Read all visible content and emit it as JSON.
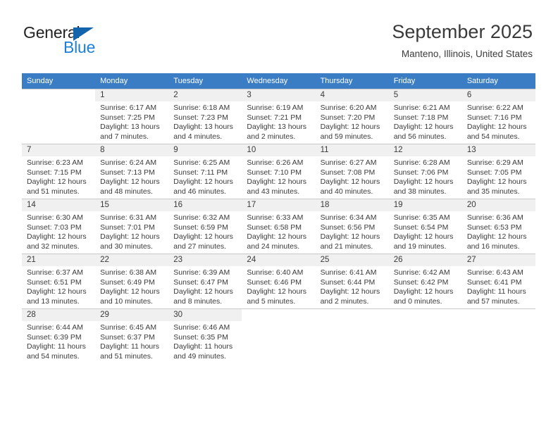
{
  "brand": {
    "name_top": "General",
    "name_bottom": "Blue",
    "color_blue": "#1e7fd4",
    "color_triangle": "#1264ac",
    "color_dark": "#222222"
  },
  "header": {
    "month_title": "September 2025",
    "location": "Manteno, Illinois, United States"
  },
  "calendar": {
    "header_bg": "#3b7dc4",
    "daynum_bg": "#f0f0f0",
    "grid_line": "#c9c9c9",
    "weekday_headers": [
      "Sunday",
      "Monday",
      "Tuesday",
      "Wednesday",
      "Thursday",
      "Friday",
      "Saturday"
    ],
    "weeks": [
      [
        {
          "day": "",
          "sunrise": "",
          "sunset": "",
          "daylight_line1": "",
          "daylight_line2": ""
        },
        {
          "day": "1",
          "sunrise": "Sunrise: 6:17 AM",
          "sunset": "Sunset: 7:25 PM",
          "daylight_line1": "Daylight: 13 hours",
          "daylight_line2": "and 7 minutes."
        },
        {
          "day": "2",
          "sunrise": "Sunrise: 6:18 AM",
          "sunset": "Sunset: 7:23 PM",
          "daylight_line1": "Daylight: 13 hours",
          "daylight_line2": "and 4 minutes."
        },
        {
          "day": "3",
          "sunrise": "Sunrise: 6:19 AM",
          "sunset": "Sunset: 7:21 PM",
          "daylight_line1": "Daylight: 13 hours",
          "daylight_line2": "and 2 minutes."
        },
        {
          "day": "4",
          "sunrise": "Sunrise: 6:20 AM",
          "sunset": "Sunset: 7:20 PM",
          "daylight_line1": "Daylight: 12 hours",
          "daylight_line2": "and 59 minutes."
        },
        {
          "day": "5",
          "sunrise": "Sunrise: 6:21 AM",
          "sunset": "Sunset: 7:18 PM",
          "daylight_line1": "Daylight: 12 hours",
          "daylight_line2": "and 56 minutes."
        },
        {
          "day": "6",
          "sunrise": "Sunrise: 6:22 AM",
          "sunset": "Sunset: 7:16 PM",
          "daylight_line1": "Daylight: 12 hours",
          "daylight_line2": "and 54 minutes."
        }
      ],
      [
        {
          "day": "7",
          "sunrise": "Sunrise: 6:23 AM",
          "sunset": "Sunset: 7:15 PM",
          "daylight_line1": "Daylight: 12 hours",
          "daylight_line2": "and 51 minutes."
        },
        {
          "day": "8",
          "sunrise": "Sunrise: 6:24 AM",
          "sunset": "Sunset: 7:13 PM",
          "daylight_line1": "Daylight: 12 hours",
          "daylight_line2": "and 48 minutes."
        },
        {
          "day": "9",
          "sunrise": "Sunrise: 6:25 AM",
          "sunset": "Sunset: 7:11 PM",
          "daylight_line1": "Daylight: 12 hours",
          "daylight_line2": "and 46 minutes."
        },
        {
          "day": "10",
          "sunrise": "Sunrise: 6:26 AM",
          "sunset": "Sunset: 7:10 PM",
          "daylight_line1": "Daylight: 12 hours",
          "daylight_line2": "and 43 minutes."
        },
        {
          "day": "11",
          "sunrise": "Sunrise: 6:27 AM",
          "sunset": "Sunset: 7:08 PM",
          "daylight_line1": "Daylight: 12 hours",
          "daylight_line2": "and 40 minutes."
        },
        {
          "day": "12",
          "sunrise": "Sunrise: 6:28 AM",
          "sunset": "Sunset: 7:06 PM",
          "daylight_line1": "Daylight: 12 hours",
          "daylight_line2": "and 38 minutes."
        },
        {
          "day": "13",
          "sunrise": "Sunrise: 6:29 AM",
          "sunset": "Sunset: 7:05 PM",
          "daylight_line1": "Daylight: 12 hours",
          "daylight_line2": "and 35 minutes."
        }
      ],
      [
        {
          "day": "14",
          "sunrise": "Sunrise: 6:30 AM",
          "sunset": "Sunset: 7:03 PM",
          "daylight_line1": "Daylight: 12 hours",
          "daylight_line2": "and 32 minutes."
        },
        {
          "day": "15",
          "sunrise": "Sunrise: 6:31 AM",
          "sunset": "Sunset: 7:01 PM",
          "daylight_line1": "Daylight: 12 hours",
          "daylight_line2": "and 30 minutes."
        },
        {
          "day": "16",
          "sunrise": "Sunrise: 6:32 AM",
          "sunset": "Sunset: 6:59 PM",
          "daylight_line1": "Daylight: 12 hours",
          "daylight_line2": "and 27 minutes."
        },
        {
          "day": "17",
          "sunrise": "Sunrise: 6:33 AM",
          "sunset": "Sunset: 6:58 PM",
          "daylight_line1": "Daylight: 12 hours",
          "daylight_line2": "and 24 minutes."
        },
        {
          "day": "18",
          "sunrise": "Sunrise: 6:34 AM",
          "sunset": "Sunset: 6:56 PM",
          "daylight_line1": "Daylight: 12 hours",
          "daylight_line2": "and 21 minutes."
        },
        {
          "day": "19",
          "sunrise": "Sunrise: 6:35 AM",
          "sunset": "Sunset: 6:54 PM",
          "daylight_line1": "Daylight: 12 hours",
          "daylight_line2": "and 19 minutes."
        },
        {
          "day": "20",
          "sunrise": "Sunrise: 6:36 AM",
          "sunset": "Sunset: 6:53 PM",
          "daylight_line1": "Daylight: 12 hours",
          "daylight_line2": "and 16 minutes."
        }
      ],
      [
        {
          "day": "21",
          "sunrise": "Sunrise: 6:37 AM",
          "sunset": "Sunset: 6:51 PM",
          "daylight_line1": "Daylight: 12 hours",
          "daylight_line2": "and 13 minutes."
        },
        {
          "day": "22",
          "sunrise": "Sunrise: 6:38 AM",
          "sunset": "Sunset: 6:49 PM",
          "daylight_line1": "Daylight: 12 hours",
          "daylight_line2": "and 10 minutes."
        },
        {
          "day": "23",
          "sunrise": "Sunrise: 6:39 AM",
          "sunset": "Sunset: 6:47 PM",
          "daylight_line1": "Daylight: 12 hours",
          "daylight_line2": "and 8 minutes."
        },
        {
          "day": "24",
          "sunrise": "Sunrise: 6:40 AM",
          "sunset": "Sunset: 6:46 PM",
          "daylight_line1": "Daylight: 12 hours",
          "daylight_line2": "and 5 minutes."
        },
        {
          "day": "25",
          "sunrise": "Sunrise: 6:41 AM",
          "sunset": "Sunset: 6:44 PM",
          "daylight_line1": "Daylight: 12 hours",
          "daylight_line2": "and 2 minutes."
        },
        {
          "day": "26",
          "sunrise": "Sunrise: 6:42 AM",
          "sunset": "Sunset: 6:42 PM",
          "daylight_line1": "Daylight: 12 hours",
          "daylight_line2": "and 0 minutes."
        },
        {
          "day": "27",
          "sunrise": "Sunrise: 6:43 AM",
          "sunset": "Sunset: 6:41 PM",
          "daylight_line1": "Daylight: 11 hours",
          "daylight_line2": "and 57 minutes."
        }
      ],
      [
        {
          "day": "28",
          "sunrise": "Sunrise: 6:44 AM",
          "sunset": "Sunset: 6:39 PM",
          "daylight_line1": "Daylight: 11 hours",
          "daylight_line2": "and 54 minutes."
        },
        {
          "day": "29",
          "sunrise": "Sunrise: 6:45 AM",
          "sunset": "Sunset: 6:37 PM",
          "daylight_line1": "Daylight: 11 hours",
          "daylight_line2": "and 51 minutes."
        },
        {
          "day": "30",
          "sunrise": "Sunrise: 6:46 AM",
          "sunset": "Sunset: 6:35 PM",
          "daylight_line1": "Daylight: 11 hours",
          "daylight_line2": "and 49 minutes."
        },
        {
          "day": "",
          "sunrise": "",
          "sunset": "",
          "daylight_line1": "",
          "daylight_line2": ""
        },
        {
          "day": "",
          "sunrise": "",
          "sunset": "",
          "daylight_line1": "",
          "daylight_line2": ""
        },
        {
          "day": "",
          "sunrise": "",
          "sunset": "",
          "daylight_line1": "",
          "daylight_line2": ""
        },
        {
          "day": "",
          "sunrise": "",
          "sunset": "",
          "daylight_line1": "",
          "daylight_line2": ""
        }
      ]
    ]
  }
}
